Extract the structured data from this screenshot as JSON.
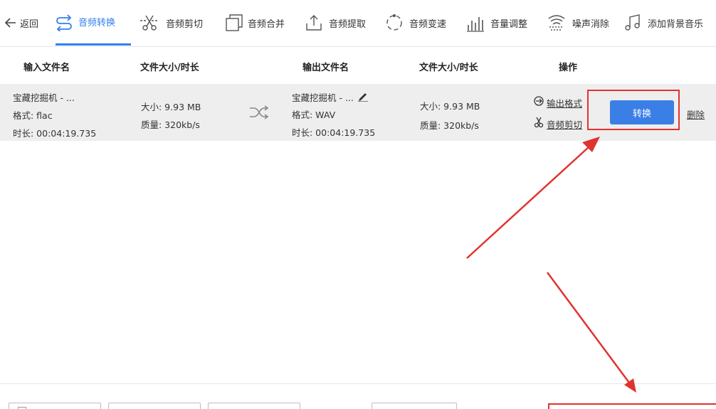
{
  "toolbar": {
    "back_label": "返回",
    "items": [
      {
        "label": "音频转换",
        "icon": "convert-icon"
      },
      {
        "label": "音频剪切",
        "icon": "scissors-icon"
      },
      {
        "label": "音频合并",
        "icon": "merge-icon"
      },
      {
        "label": "音频提取",
        "icon": "upload-icon"
      },
      {
        "label": "音频变速",
        "icon": "speed-icon"
      },
      {
        "label": "音量调整",
        "icon": "volume-bars-icon"
      },
      {
        "label": "噪声消除",
        "icon": "wave-icon"
      },
      {
        "label": "添加背景音乐",
        "icon": "music-note-icon"
      }
    ],
    "active_color": "#2f80ed"
  },
  "table": {
    "headers": {
      "input_name": "输入文件名",
      "input_size": "文件大小/时长",
      "output_name": "输出文件名",
      "output_size": "文件大小/时长",
      "actions": "操作"
    },
    "rows": [
      {
        "input": {
          "name": "宝藏挖掘机 - ...",
          "format": "格式:  flac",
          "duration": "时长:  00:04:19.735",
          "size": "大小:  9.93 MB",
          "quality": "质量:  320kb/s"
        },
        "output": {
          "name": "宝藏挖掘机 - ...",
          "format": "格式:  WAV",
          "duration": "时长:  00:04:19.735",
          "size": "大小:  9.93 MB",
          "quality": "质量:  320kb/s"
        },
        "actions": {
          "output_format": "输出格式",
          "audio_cut": "音频剪切",
          "convert": "转换",
          "delete": "删除"
        }
      }
    ]
  },
  "colors": {
    "accent": "#2f80ed",
    "button": "#3a7fe6",
    "annotation": "#e0332f",
    "row_bg": "#eeeeee"
  }
}
